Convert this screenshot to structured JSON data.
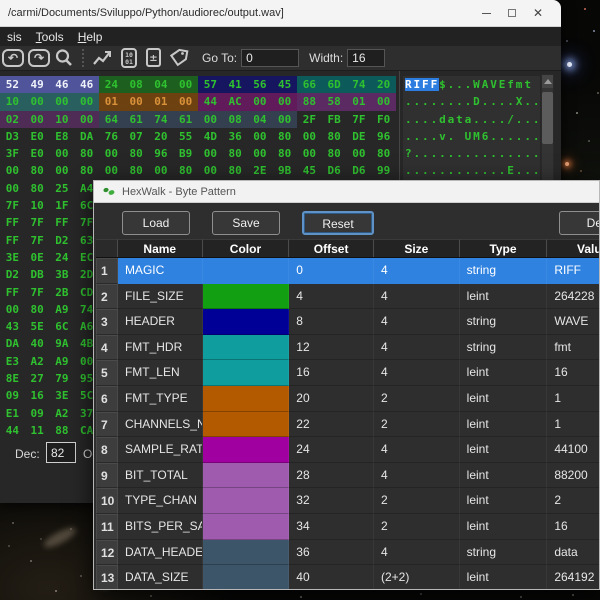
{
  "window": {
    "title": "/carmi/Documents/Sviluppo/Python/audiorec/output.wav]",
    "close_glyph": "✕"
  },
  "menu": {
    "items": [
      {
        "pre": "sis",
        "u": "",
        "post": ""
      },
      {
        "pre": "",
        "u": "T",
        "post": "ools"
      },
      {
        "pre": "",
        "u": "H",
        "post": "elp"
      }
    ]
  },
  "toolbar": {
    "undo_glyph": "↶",
    "redo_glyph": "↷",
    "goto_label": "Go To:",
    "goto_value": "0",
    "width_label": "Width:",
    "width_value": "16"
  },
  "hex": {
    "rows": [
      [
        "52",
        "49",
        "46",
        "46",
        "24",
        "08",
        "04",
        "00",
        "57",
        "41",
        "56",
        "45",
        "66",
        "6D",
        "74",
        "20"
      ],
      [
        "10",
        "00",
        "00",
        "00",
        "01",
        "00",
        "01",
        "00",
        "44",
        "AC",
        "00",
        "00",
        "88",
        "58",
        "01",
        "00"
      ],
      [
        "02",
        "00",
        "10",
        "00",
        "64",
        "61",
        "74",
        "61",
        "00",
        "08",
        "04",
        "00",
        "2F",
        "FB",
        "7F",
        "F0"
      ],
      [
        "D3",
        "E0",
        "E8",
        "DA",
        "76",
        "07",
        "20",
        "55",
        "4D",
        "36",
        "00",
        "80",
        "00",
        "80",
        "DE",
        "96"
      ],
      [
        "3F",
        "E0",
        "00",
        "80",
        "00",
        "80",
        "96",
        "B9",
        "00",
        "80",
        "00",
        "80",
        "00",
        "80",
        "00",
        "80"
      ],
      [
        "00",
        "80",
        "00",
        "80",
        "00",
        "80",
        "00",
        "80",
        "00",
        "80",
        "2E",
        "9B",
        "45",
        "D6",
        "D6",
        "99"
      ],
      [
        "00",
        "80",
        "25",
        "A4"
      ],
      [
        "7F",
        "10",
        "1F",
        "6C"
      ],
      [
        "FF",
        "7F",
        "FF",
        "7F"
      ],
      [
        "FF",
        "7F",
        "D2",
        "63"
      ],
      [
        "3E",
        "0E",
        "24",
        "EC"
      ],
      [
        "D2",
        "DB",
        "3B",
        "2D"
      ],
      [
        "FF",
        "7F",
        "2B",
        "CD"
      ],
      [
        "00",
        "80",
        "A9",
        "74"
      ],
      [
        "43",
        "5E",
        "6C",
        "A6"
      ],
      [
        "DA",
        "40",
        "9A",
        "4B"
      ],
      [
        "E3",
        "A2",
        "A9",
        "00"
      ],
      [
        "8E",
        "27",
        "79",
        "95"
      ],
      [
        "09",
        "16",
        "3E",
        "5C"
      ],
      [
        "E1",
        "09",
        "A2",
        "37"
      ],
      [
        "44",
        "11",
        "88",
        "CA"
      ]
    ],
    "byte_colors": [
      {
        "start": 0,
        "end": 3,
        "bg": "#4f549b",
        "fg": "#eef0fa"
      },
      {
        "start": 4,
        "end": 7,
        "bg": "#1c5f1e"
      },
      {
        "start": 8,
        "end": 11,
        "bg": "#161660"
      },
      {
        "start": 12,
        "end": 15,
        "bg": "#0c5a5a"
      },
      {
        "start": 16,
        "end": 19,
        "bg": "#29605f"
      },
      {
        "start": 20,
        "end": 23,
        "bg": "#6e4210",
        "fg": "#d9913a"
      },
      {
        "start": 24,
        "end": 27,
        "bg": "#611a5a"
      },
      {
        "start": 28,
        "end": 31,
        "bg": "#5c2a63"
      },
      {
        "start": 32,
        "end": 35,
        "bg": "#4f2c55"
      },
      {
        "start": 36,
        "end": 43,
        "bg": "#344050"
      }
    ]
  },
  "ascii": {
    "rows": [
      {
        "hl": "RIFF",
        "text": "$...WAVEfmt "
      },
      {
        "text": "........D....X.."
      },
      {
        "text": "....data..../..."
      },
      {
        "text": "....v. UM6......"
      },
      {
        "text": "?..............."
      },
      {
        "text": "............E..."
      }
    ]
  },
  "status": {
    "dec_label": "Dec:",
    "dec_value": "82",
    "oct_label": "Oct:"
  },
  "dialog": {
    "title": "HexWalk - Byte Pattern",
    "buttons": {
      "load": "Load",
      "save": "Save",
      "reset": "Reset",
      "delete": "Delete"
    },
    "table": {
      "headers": [
        "Name",
        "Color",
        "Offset",
        "Size",
        "Type",
        "Value"
      ],
      "rows": [
        {
          "num": "1",
          "name": "MAGIC",
          "color": "#2f82e0",
          "offset": "0",
          "size": "4",
          "type": "string",
          "value": "RIFF",
          "selected": true
        },
        {
          "num": "2",
          "name": "FILE_SIZE",
          "color": "#12a012",
          "offset": "4",
          "size": "4",
          "type": "leint",
          "value": "264228"
        },
        {
          "num": "3",
          "name": "HEADER",
          "color": "#000096",
          "offset": "8",
          "size": "4",
          "type": "string",
          "value": "WAVE"
        },
        {
          "num": "4",
          "name": "FMT_HDR",
          "color": "#0f9d9d",
          "offset": "12",
          "size": "4",
          "type": "string",
          "value": "fmt"
        },
        {
          "num": "5",
          "name": "FMT_LEN",
          "color": "#0f9d9d",
          "offset": "16",
          "size": "4",
          "type": "leint",
          "value": "16"
        },
        {
          "num": "6",
          "name": "FMT_TYPE",
          "color": "#b35a00",
          "offset": "20",
          "size": "2",
          "type": "leint",
          "value": "1"
        },
        {
          "num": "7",
          "name": "CHANNELS_NUM",
          "color": "#b35a00",
          "offset": "22",
          "size": "2",
          "type": "leint",
          "value": "1"
        },
        {
          "num": "8",
          "name": "SAMPLE_RATE",
          "color": "#a000a0",
          "offset": "24",
          "size": "4",
          "type": "leint",
          "value": "44100"
        },
        {
          "num": "9",
          "name": "BIT_TOTAL",
          "color": "#9f5caf",
          "offset": "28",
          "size": "4",
          "type": "leint",
          "value": "88200"
        },
        {
          "num": "10",
          "name": "TYPE_CHAN",
          "color": "#9f5caf",
          "offset": "32",
          "size": "2",
          "type": "leint",
          "value": "2"
        },
        {
          "num": "11",
          "name": "BITS_PER_SA...",
          "color": "#9f5caf",
          "offset": "34",
          "size": "2",
          "type": "leint",
          "value": "16"
        },
        {
          "num": "12",
          "name": "DATA_HEADER",
          "color": "#3d5568",
          "offset": "36",
          "size": "4",
          "type": "string",
          "value": "data"
        },
        {
          "num": "13",
          "name": "DATA_SIZE",
          "color": "#3d5568",
          "offset": "40",
          "size": "(2+2)",
          "type": "leint",
          "value": "264192"
        }
      ]
    }
  }
}
